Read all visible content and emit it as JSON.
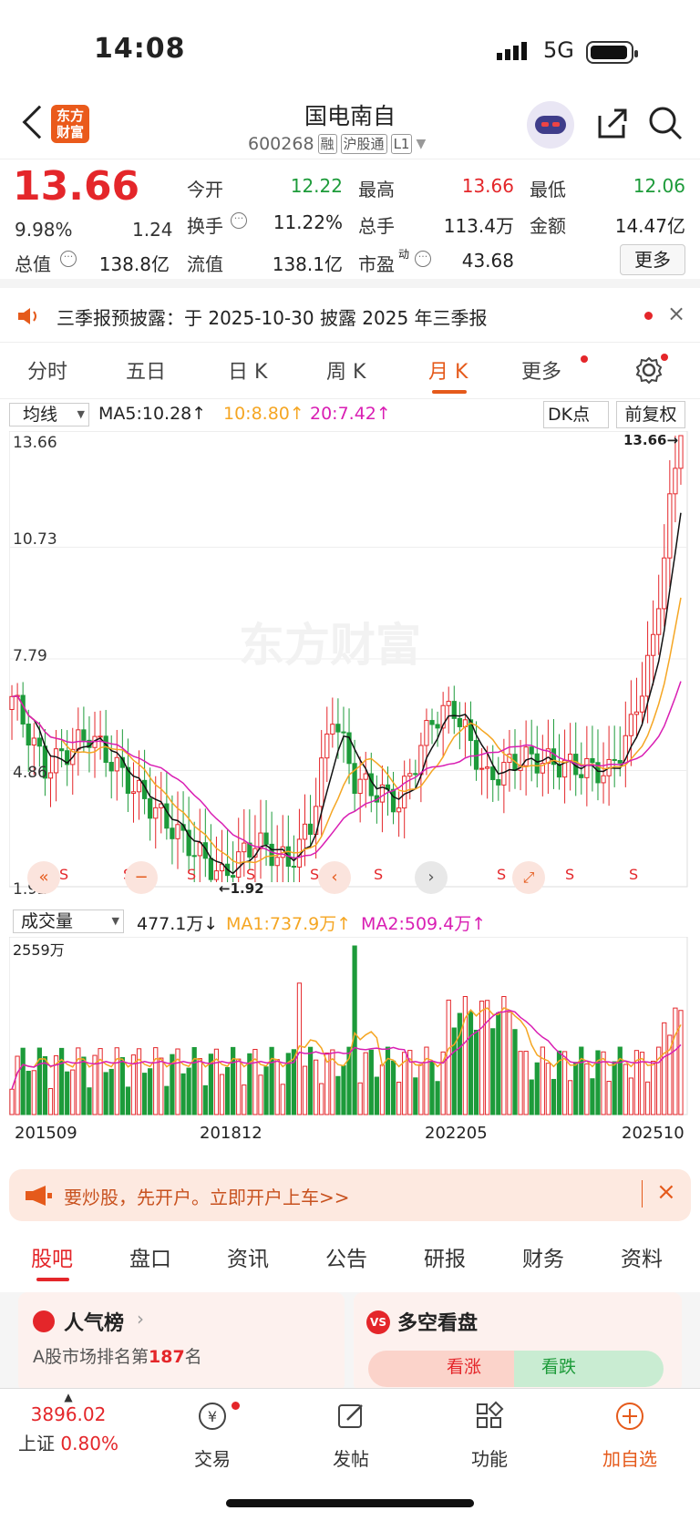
{
  "status": {
    "time": "14:08",
    "network": "5G"
  },
  "header": {
    "title": "国电南自",
    "code": "600268",
    "tags": [
      "融",
      "沪股通",
      "L1"
    ],
    "logo": "东方\n财富"
  },
  "quote": {
    "price": "13.66",
    "pct": "9.98%",
    "chg": "1.24",
    "rows": [
      {
        "l1": "今开",
        "v1": "12.22",
        "l2": "最高",
        "v2": "13.66",
        "l3": "最低",
        "v3": "12.06"
      },
      {
        "l1": "换手",
        "v1": "11.22%",
        "l2": "总手",
        "v2": "113.4万",
        "l3": "金额",
        "v3": "14.47亿"
      },
      {
        "l1": "总值",
        "v1": "138.8亿",
        "l2": "流值",
        "v2": "138.1亿",
        "l3": "市盈",
        "v3": "43.68"
      }
    ],
    "more": "更多"
  },
  "notice": "三季报预披露：于 2025-10-30 披露 2025 年三季报",
  "tabs": [
    "分时",
    "五日",
    "日 K",
    "周 K",
    "月 K",
    "更多"
  ],
  "ma": {
    "select": "均线",
    "ma5": "MA5:10.28↑",
    "ma10": "10:8.80↑",
    "ma20": "20:7.42↑",
    "dk": "DK点",
    "fq": "前复权"
  },
  "price_axis": [
    "13.66",
    "10.73",
    "7.79",
    "4.86",
    "1.92"
  ],
  "markers": {
    "high": "13.66→",
    "low": "←1.92"
  },
  "vol": {
    "select": "成交量",
    "val": "477.1万↓",
    "ma1": "MA1:737.9万↑",
    "ma2": "MA2:509.4万↑",
    "max": "2559万"
  },
  "dates": [
    "201509",
    "201812",
    "202205",
    "202510"
  ],
  "colors": {
    "up": "#e4262a",
    "down": "#1d9b3a",
    "ma5": "#111111",
    "ma10": "#f5a623",
    "ma20": "#d91eb3",
    "accent": "#e55a1b"
  },
  "chart_data": {
    "type": "candlestick",
    "period": "monthly",
    "ylim": [
      1.92,
      13.66
    ],
    "last_close": 13.66,
    "ma_lines": {
      "MA5": 10.28,
      "MA10": 8.8,
      "MA20": 7.42
    },
    "volume": {
      "last": "477.1万",
      "ma1": "737.9万",
      "ma2": "509.4万",
      "max": "2559万"
    },
    "x_ticks": [
      "201509",
      "201812",
      "202205",
      "202510"
    ]
  },
  "promo": "要炒股，先开户。立即开户上车>>",
  "bottom_tabs": [
    "股吧",
    "盘口",
    "资讯",
    "公告",
    "研报",
    "财务",
    "资料"
  ],
  "cards": {
    "left_title": "人气榜",
    "left_text_a": "A股市场排名第",
    "left_rank": "187",
    "left_text_b": "名",
    "right_title": "多空看盘",
    "up": "看涨",
    "down": "看跌"
  },
  "tabbar": [
    {
      "label": "上证",
      "value": "3896.02",
      "pct": "0.80%"
    },
    {
      "label": "交易"
    },
    {
      "label": "发帖"
    },
    {
      "label": "功能"
    },
    {
      "label": "加自选"
    }
  ]
}
